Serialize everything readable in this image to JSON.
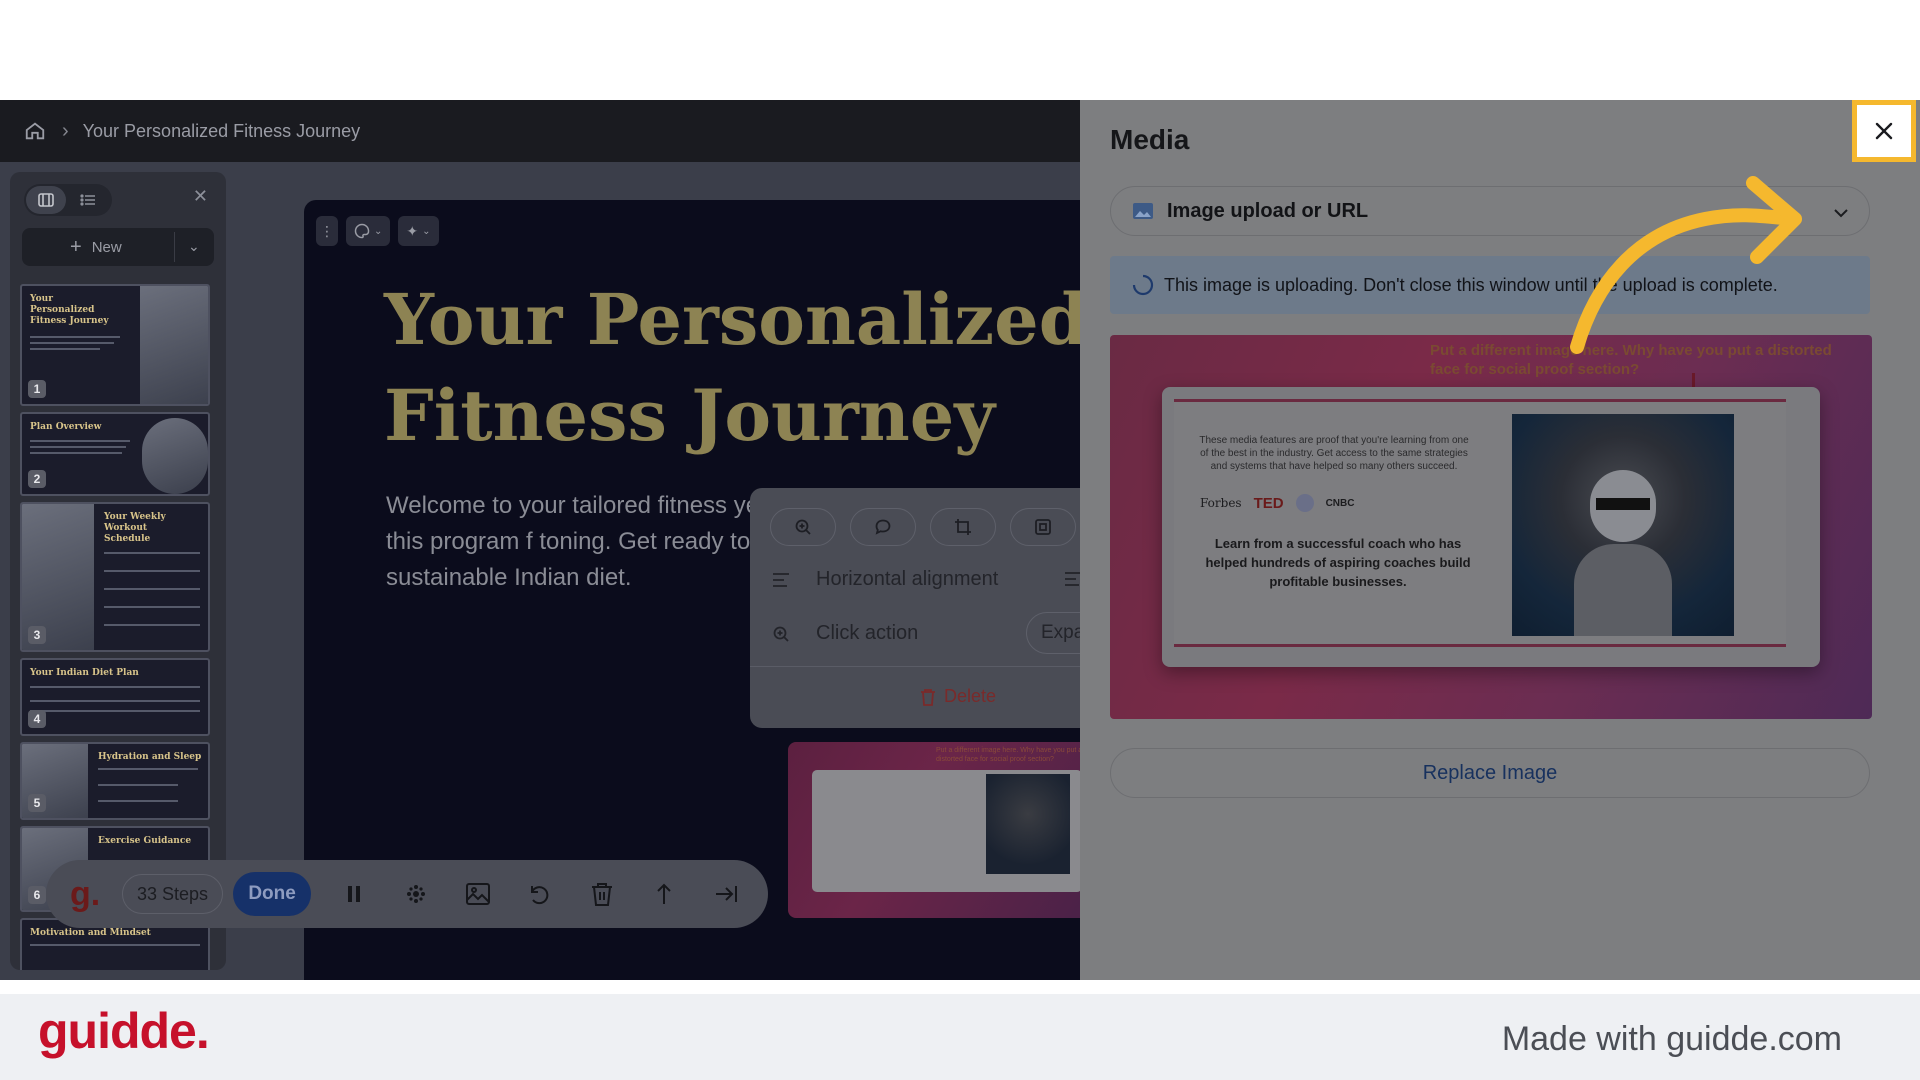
{
  "breadcrumb": {
    "title": "Your Personalized Fitness Journey"
  },
  "sidebar": {
    "new_label": "New",
    "slides": [
      {
        "num": "1",
        "title": "Your Personalized Fitness Journey"
      },
      {
        "num": "2",
        "title": "Plan Overview"
      },
      {
        "num": "3",
        "title": "Your Weekly Workout Schedule"
      },
      {
        "num": "4",
        "title": "Your Indian Diet Plan"
      },
      {
        "num": "5",
        "title": "Hydration and Sleep"
      },
      {
        "num": "6",
        "title": "Exercise Guidance"
      },
      {
        "num": "",
        "title": "Motivation and Mindset"
      }
    ]
  },
  "slide": {
    "title_line1": "Your Personalized",
    "title_line2": "Fitness Journey",
    "body": "Welcome to your tailored fitness year-old beginner, this program f toning. Get ready to transform yo sustainable Indian diet."
  },
  "context_menu": {
    "horizontal_alignment": "Horizontal alignment",
    "click_action": "Click action",
    "expand": "Expa",
    "delete": "Delete"
  },
  "tray": {
    "logo": "g.",
    "steps": "33 Steps",
    "done": "Done"
  },
  "media": {
    "title": "Media",
    "source_select": "Image upload or URL",
    "upload_notice": "This image is uploading. Don't close this window until the upload is complete.",
    "image_caption": "Put a different image here. Why have you put a distorted face for social proof section?",
    "image_lead": "These media features are proof that you're learning from one of the best in the industry. Get access to the same strategies and systems that have helped so many others succeed.",
    "image_logos": [
      "Forbes",
      "TED",
      "CNBC"
    ],
    "image_body": "Learn from a successful coach who has helped hundreds of aspiring coaches build profitable businesses.",
    "replace_label": "Replace Image"
  },
  "footer": {
    "brand": "guidde.",
    "made_with": "Made with guidde.com"
  },
  "colors": {
    "brand_red": "#c6112b",
    "highlight": "#f5b82e",
    "accent_blue": "#163169"
  }
}
